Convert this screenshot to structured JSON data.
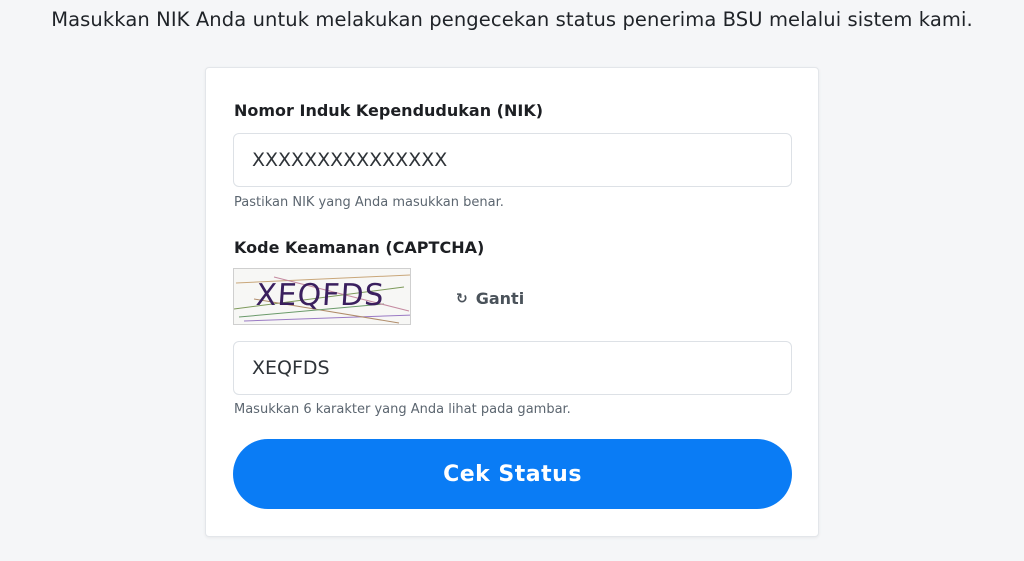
{
  "intro_text": "Masukkan NIK Anda untuk melakukan pengecekan status penerima BSU melalui sistem kami.",
  "form": {
    "nik": {
      "label": "Nomor Induk Kependudukan (NIK)",
      "value": "XXXXXXXXXXXXXXX",
      "hint": "Pastikan NIK yang Anda masukkan benar."
    },
    "captcha": {
      "label": "Kode Keamanan (CAPTCHA)",
      "image_text": "XEQFDS",
      "refresh_icon": "refresh-icon",
      "refresh_label": "Ganti",
      "value": "XEQFDS",
      "hint": "Masukkan 6 karakter yang Anda lihat pada gambar."
    },
    "submit_label": "Cek Status"
  },
  "colors": {
    "primary": "#0a7cf5",
    "background": "#f5f6f8",
    "card": "#ffffff"
  }
}
